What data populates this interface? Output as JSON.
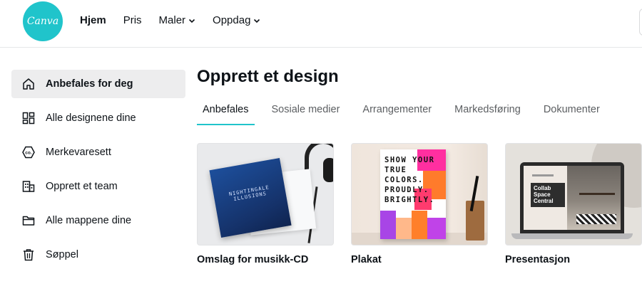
{
  "header": {
    "logo_text": "Canva",
    "nav": [
      {
        "label": "Hjem",
        "active": true,
        "dropdown": false
      },
      {
        "label": "Pris",
        "active": false,
        "dropdown": false
      },
      {
        "label": "Maler",
        "active": false,
        "dropdown": true
      },
      {
        "label": "Oppdag",
        "active": false,
        "dropdown": true
      }
    ]
  },
  "sidebar": {
    "items": [
      {
        "label": "Anbefales for deg",
        "icon": "home-icon",
        "active": true
      },
      {
        "label": "Alle designene dine",
        "icon": "grid-icon",
        "active": false
      },
      {
        "label": "Merkevaresett",
        "icon": "brand-kit-icon",
        "active": false
      },
      {
        "label": "Opprett et team",
        "icon": "team-building-icon",
        "active": false
      },
      {
        "label": "Alle mappene dine",
        "icon": "folder-icon",
        "active": false
      },
      {
        "label": "Søppel",
        "icon": "trash-icon",
        "active": false
      }
    ]
  },
  "main": {
    "title": "Opprett et design",
    "tabs": [
      {
        "label": "Anbefales",
        "active": true
      },
      {
        "label": "Sosiale medier",
        "active": false
      },
      {
        "label": "Arrangementer",
        "active": false
      },
      {
        "label": "Markedsføring",
        "active": false
      },
      {
        "label": "Dokumenter",
        "active": false
      }
    ],
    "cards": [
      {
        "label": "Omslag for musikk-CD",
        "thumb_text": "NIGHTINGALE ILLUSIONS"
      },
      {
        "label": "Plakat",
        "thumb_text": "SHOW YOUR TRUE COLORS. PROUDLY. BRIGHTLY."
      },
      {
        "label": "Presentasjon",
        "thumb_text": "Collab Space Central"
      }
    ]
  },
  "colors": {
    "brand": "#20c4cb",
    "active_bg": "#ededee",
    "text": "#0e1318",
    "muted": "#5c5f62"
  }
}
